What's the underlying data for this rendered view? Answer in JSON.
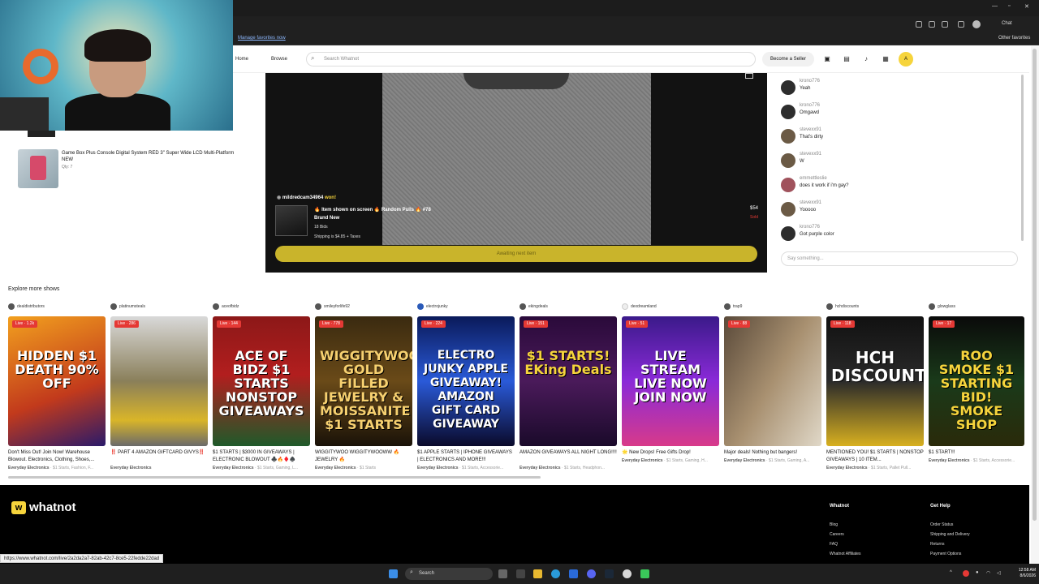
{
  "browser": {
    "favorites_link": "Manage favorites now",
    "other_favorites": "Other favorites",
    "chat_button": "Chat"
  },
  "header": {
    "home": "Home",
    "browse": "Browse",
    "search_placeholder": "Search Whatnot",
    "become_seller": "Become a Seller",
    "avatar_initial": "A"
  },
  "left_panel": {
    "item_title": "Game Box Plus Console Digital System RED 3\" Super Wide LCD Multi-Platform NEW",
    "item_qty": "Qty: 7"
  },
  "player": {
    "winner_name": "mildredcam34964",
    "winner_suffix": "won!",
    "product_title": "🔥 Item shown on screen 🔥 Random Pulls 🔥 #78",
    "condition": "Brand New",
    "bids": "18 Bids",
    "shipping": "Shipping is $4.85 + Taxes",
    "price": "$54",
    "sold_label": "Sold",
    "awaiting": "Awaiting next item"
  },
  "chat": {
    "messages": [
      {
        "user": "krono776",
        "text": "Yeah"
      },
      {
        "user": "krono776",
        "text": "Omgawd"
      },
      {
        "user": "stevexx91",
        "text": "That's dirty"
      },
      {
        "user": "stevexx91",
        "text": "W"
      },
      {
        "user": "emmettleslie",
        "text": "does it work if i'm gay?"
      },
      {
        "user": "stevexx91",
        "text": "Yooooo"
      },
      {
        "user": "krono776",
        "text": "Got purple color"
      }
    ],
    "input_placeholder": "Say something..."
  },
  "explore": {
    "title": "Explore more shows",
    "shows": [
      {
        "host": "dealdistributors",
        "live": "Live · 1.2k",
        "thumb": "HIDDEN $1 DEATH 90% OFF",
        "title": "Don't Miss Out! Join Now! Warehouse Blowout. Electronics, Clothing, Shoes,...",
        "category": "Everyday Electronics",
        "tags": "· $1 Starts, Fashion, F..."
      },
      {
        "host": "platinumsteals",
        "live": "Live · 286",
        "thumb": "",
        "title": "‼️ PART 4 AMAZON GIFTCARD GIVYS‼️",
        "category": "Everyday Electronics",
        "tags": ""
      },
      {
        "host": "aceofbidz",
        "live": "Live · 144",
        "thumb": "ACE OF BIDZ $1 STARTS NONSTOP GIVEAWAYS",
        "title": "$1 STARTS | $3000 IN GIVEAWAYS | ELECTRONIC BLOWOUT ♣️🔥♦️♠️",
        "category": "Everyday Electronics",
        "tags": "· $1 Starts, Gaming, L..."
      },
      {
        "host": "smileyforlife92",
        "live": "Live · 778",
        "thumb": "WIGGITYWOO GOLD FILLED JEWELRY & MOISSANITE $1 STARTS",
        "title": "WIGGITYWOO WIGGITYWOOWW 🔥 JEWELRY 🔥",
        "category": "Everyday Electronics",
        "tags": "· $1 Starts"
      },
      {
        "host": "electrojunky",
        "live": "Live · 224",
        "thumb": "ELECTRO JUNKY APPLE GIVEAWAY! AMAZON GIFT CARD GIVEAWAY",
        "title": "$1 APPLE STARTS | IPHONE GIVEAWAYS | ELECTRONICS AND MORE!!!",
        "category": "Everyday Electronics",
        "tags": "· $1 Starts, Accessorie..."
      },
      {
        "host": "ekingdeals",
        "live": "Live · 151",
        "thumb": "$1 STARTS! EKing Deals",
        "title": "AMAZON GIVEAWAYS ALL NIGHT LONG!!!!",
        "category": "Everyday Electronics",
        "tags": "· $1 Starts, Headphon..."
      },
      {
        "host": "dexdreamland",
        "live": "Live · 51",
        "thumb": "LIVE STREAM LIVE NOW JOIN NOW",
        "title": "🌟 New Drops! Free Gifts Drop!",
        "category": "Everyday Electronics",
        "tags": "· $1 Starts, Gaming, H..."
      },
      {
        "host": "trap9",
        "live": "Live · 88",
        "thumb": "",
        "title": "Major deals! Nothing but bangers!",
        "category": "Everyday Electronics",
        "tags": "· $1 Starts, Gaming, A..."
      },
      {
        "host": "hchdiscounts",
        "live": "Live · 118",
        "thumb": "HCH DISCOUNTS",
        "title": "MENTIONED YOU! $1 STARTS | NONSTOP GIVEAWAYS | 10 ITEM...",
        "category": "Everyday Electronics",
        "tags": "· $1 Starts, Pallet Pull..."
      },
      {
        "host": "glowglass",
        "live": "Live · 17",
        "thumb": "ROO SMOKE $1 STARTING BID! SMOKE SHOP",
        "title": "$1 START!!!",
        "category": "Everyday Electronics",
        "tags": "· $1 Starts, Accessorie..."
      }
    ]
  },
  "footer": {
    "logo": "whatnot",
    "col1_title": "Whatnot",
    "col1_links": [
      "Blog",
      "Careers",
      "FAQ",
      "Whatnot Affiliates"
    ],
    "col2_title": "Get Help",
    "col2_links": [
      "Order Status",
      "Shipping and Delivery",
      "Returns",
      "Payment Options"
    ]
  },
  "status_url": "https://www.whatnot.com/live/2a2da2a7-82ab-42c7-8ce5-22fedde22dad",
  "taskbar": {
    "search": "Search",
    "time": "12:58 AM",
    "date": "8/6/2026"
  },
  "colors": {
    "brand_yellow": "#f6d43c",
    "live_red": "#e53935",
    "await_bar": "#c9b42b"
  }
}
